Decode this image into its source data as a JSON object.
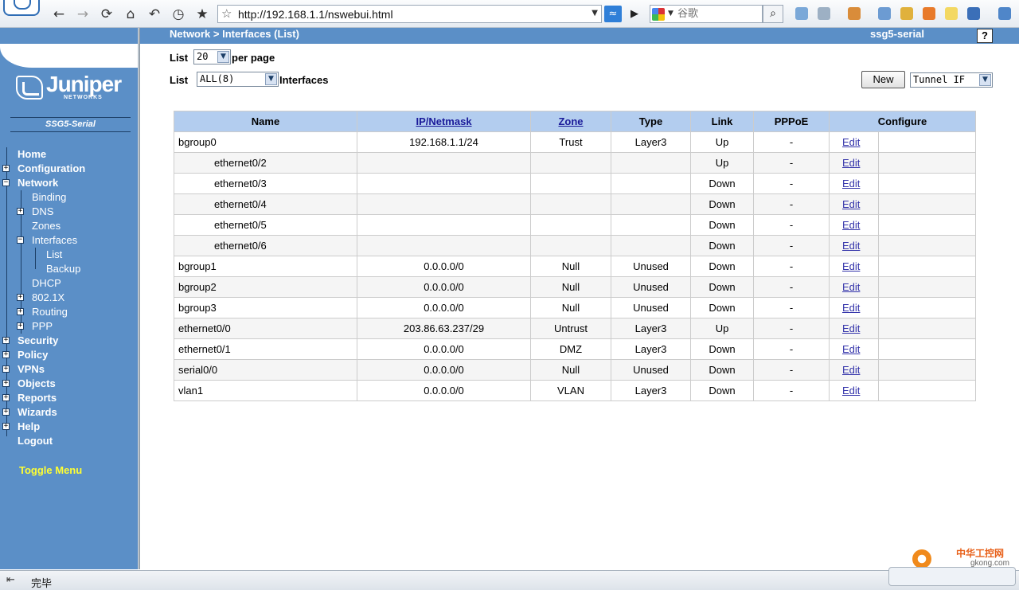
{
  "browser": {
    "url": "http://192.168.1.1/nswebui.html",
    "search_placeholder": "谷歌",
    "status": "完毕"
  },
  "header": {
    "breadcrumb": "Network > Interfaces (List)",
    "device": "ssg5-serial",
    "help": "?"
  },
  "sidebar": {
    "logo_text": "Juniper",
    "logo_sub": "NETWORKS",
    "model": "SSG5-Serial",
    "toggle_menu": "Toggle Menu",
    "items": [
      {
        "label": "Home"
      },
      {
        "label": "Configuration"
      },
      {
        "label": "Network"
      },
      {
        "label": "Binding"
      },
      {
        "label": "DNS"
      },
      {
        "label": "Zones"
      },
      {
        "label": "Interfaces"
      },
      {
        "label": "List"
      },
      {
        "label": "Backup"
      },
      {
        "label": "DHCP"
      },
      {
        "label": "802.1X"
      },
      {
        "label": "Routing"
      },
      {
        "label": "PPP"
      },
      {
        "label": "Security"
      },
      {
        "label": "Policy"
      },
      {
        "label": "VPNs"
      },
      {
        "label": "Objects"
      },
      {
        "label": "Reports"
      },
      {
        "label": "Wizards"
      },
      {
        "label": "Help"
      },
      {
        "label": "Logout"
      }
    ]
  },
  "controls": {
    "list_label": "List",
    "per_page_value": "20",
    "per_page_label": "per page",
    "filter_value": "ALL(8)",
    "interfaces_label": "Interfaces",
    "new_label": "New",
    "type_value": "Tunnel IF"
  },
  "table": {
    "headers": [
      "Name",
      "IP/Netmask",
      "Zone",
      "Type",
      "Link",
      "PPPoE",
      "Configure"
    ],
    "edit_label": "Edit",
    "rows": [
      {
        "name": "bgroup0",
        "ip": "192.168.1.1/24",
        "zone": "Trust",
        "type": "Layer3",
        "link": "Up",
        "pppoe": "-"
      },
      {
        "name": "ethernet0/2",
        "ip": "",
        "zone": "",
        "type": "",
        "link": "Up",
        "pppoe": "-"
      },
      {
        "name": "ethernet0/3",
        "ip": "",
        "zone": "",
        "type": "",
        "link": "Down",
        "pppoe": "-"
      },
      {
        "name": "ethernet0/4",
        "ip": "",
        "zone": "",
        "type": "",
        "link": "Down",
        "pppoe": "-"
      },
      {
        "name": "ethernet0/5",
        "ip": "",
        "zone": "",
        "type": "",
        "link": "Down",
        "pppoe": "-"
      },
      {
        "name": "ethernet0/6",
        "ip": "",
        "zone": "",
        "type": "",
        "link": "Down",
        "pppoe": "-"
      },
      {
        "name": "bgroup1",
        "ip": "0.0.0.0/0",
        "zone": "Null",
        "type": "Unused",
        "link": "Down",
        "pppoe": "-"
      },
      {
        "name": "bgroup2",
        "ip": "0.0.0.0/0",
        "zone": "Null",
        "type": "Unused",
        "link": "Down",
        "pppoe": "-"
      },
      {
        "name": "bgroup3",
        "ip": "0.0.0.0/0",
        "zone": "Null",
        "type": "Unused",
        "link": "Down",
        "pppoe": "-"
      },
      {
        "name": "ethernet0/0",
        "ip": "203.86.63.237/29",
        "zone": "Untrust",
        "type": "Layer3",
        "link": "Up",
        "pppoe": "-"
      },
      {
        "name": "ethernet0/1",
        "ip": "0.0.0.0/0",
        "zone": "DMZ",
        "type": "Layer3",
        "link": "Down",
        "pppoe": "-"
      },
      {
        "name": "serial0/0",
        "ip": "0.0.0.0/0",
        "zone": "Null",
        "type": "Unused",
        "link": "Down",
        "pppoe": "-"
      },
      {
        "name": "vlan1",
        "ip": "0.0.0.0/0",
        "zone": "VLAN",
        "type": "Layer3",
        "link": "Down",
        "pppoe": "-"
      }
    ]
  },
  "watermark": {
    "text": "中华工控网",
    "url": "gkong.com"
  }
}
